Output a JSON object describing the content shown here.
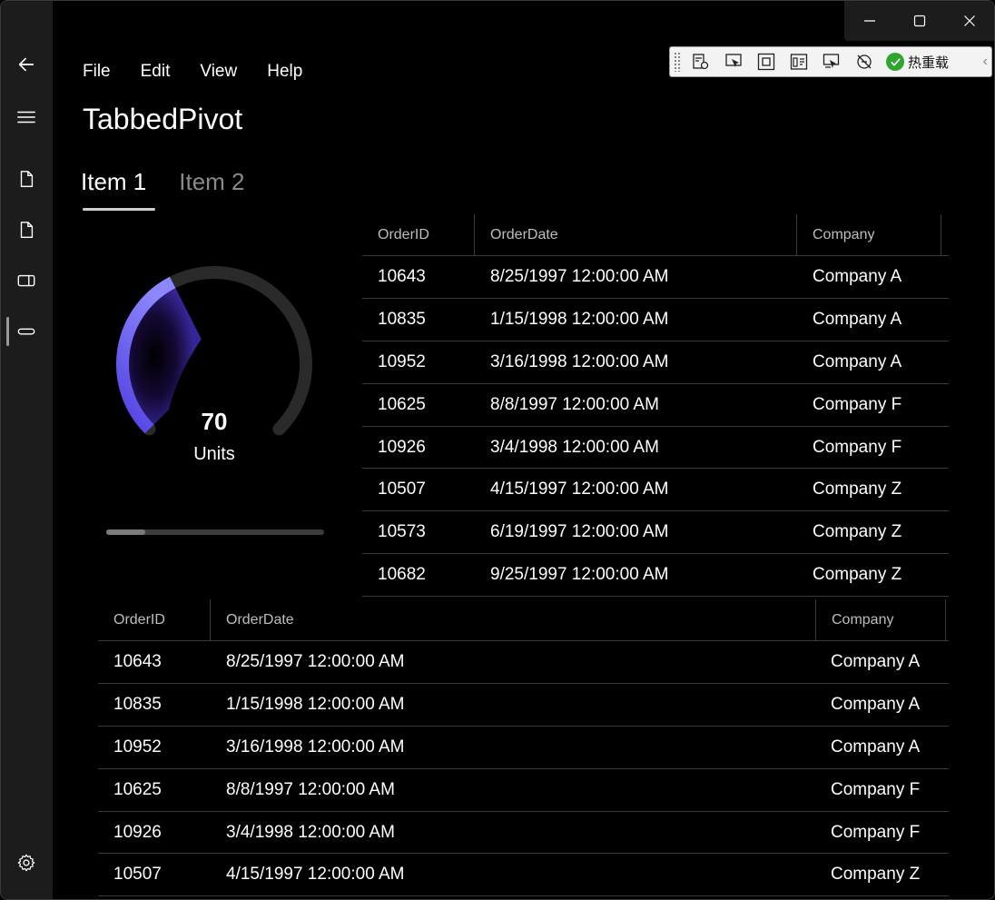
{
  "window": {
    "caption": {
      "minimize_icon": "minimize-icon",
      "maximize_icon": "maximize-icon",
      "close_icon": "close-icon"
    }
  },
  "nav": {
    "back_icon": "back-arrow-icon",
    "menu_icon": "hamburger-icon",
    "items": [
      {
        "icon": "document-icon"
      },
      {
        "icon": "document-icon"
      },
      {
        "icon": "tablet-icon"
      },
      {
        "icon": "progressbar-icon",
        "selected": true
      }
    ],
    "settings_icon": "gear-icon"
  },
  "debug_toolbar": {
    "icons": [
      "live-visual-tree-icon",
      "select-element-icon",
      "display-layout-adorners-icon",
      "track-focus-icon",
      "preview-selection-icon",
      "binding-failures-icon"
    ],
    "hot_reload_label": "热重载"
  },
  "menu": {
    "items": [
      "File",
      "Edit",
      "View",
      "Help"
    ]
  },
  "page": {
    "title": "TabbedPivot"
  },
  "tabs": [
    {
      "label": "Item 1",
      "active": true
    },
    {
      "label": "Item 2",
      "active": false
    }
  ],
  "gauge": {
    "value_text": "70",
    "units": "Units",
    "value": 70,
    "min": 0,
    "max": 100,
    "accent_color": "#6a5cff",
    "track_color": "#2a2a2a"
  },
  "scrollbar": {
    "position_fraction": 0.0,
    "thumb_fraction": 0.18
  },
  "grid_top": {
    "columns": [
      "OrderID",
      "OrderDate",
      "Company"
    ],
    "rows": [
      [
        "10643",
        "8/25/1997 12:00:00 AM",
        "Company A"
      ],
      [
        "10835",
        "1/15/1998 12:00:00 AM",
        "Company A"
      ],
      [
        "10952",
        "3/16/1998 12:00:00 AM",
        "Company A"
      ],
      [
        "10625",
        "8/8/1997 12:00:00 AM",
        "Company F"
      ],
      [
        "10926",
        "3/4/1998 12:00:00 AM",
        "Company F"
      ],
      [
        "10507",
        "4/15/1997 12:00:00 AM",
        "Company Z"
      ],
      [
        "10573",
        "6/19/1997 12:00:00 AM",
        "Company Z"
      ],
      [
        "10682",
        "9/25/1997 12:00:00 AM",
        "Company Z"
      ]
    ]
  },
  "grid_bottom": {
    "columns": [
      "OrderID",
      "OrderDate",
      "Company"
    ],
    "rows": [
      [
        "10643",
        "8/25/1997 12:00:00 AM",
        "Company A"
      ],
      [
        "10835",
        "1/15/1998 12:00:00 AM",
        "Company A"
      ],
      [
        "10952",
        "3/16/1998 12:00:00 AM",
        "Company A"
      ],
      [
        "10625",
        "8/8/1997 12:00:00 AM",
        "Company F"
      ],
      [
        "10926",
        "3/4/1998 12:00:00 AM",
        "Company F"
      ],
      [
        "10507",
        "4/15/1997 12:00:00 AM",
        "Company Z"
      ]
    ]
  }
}
